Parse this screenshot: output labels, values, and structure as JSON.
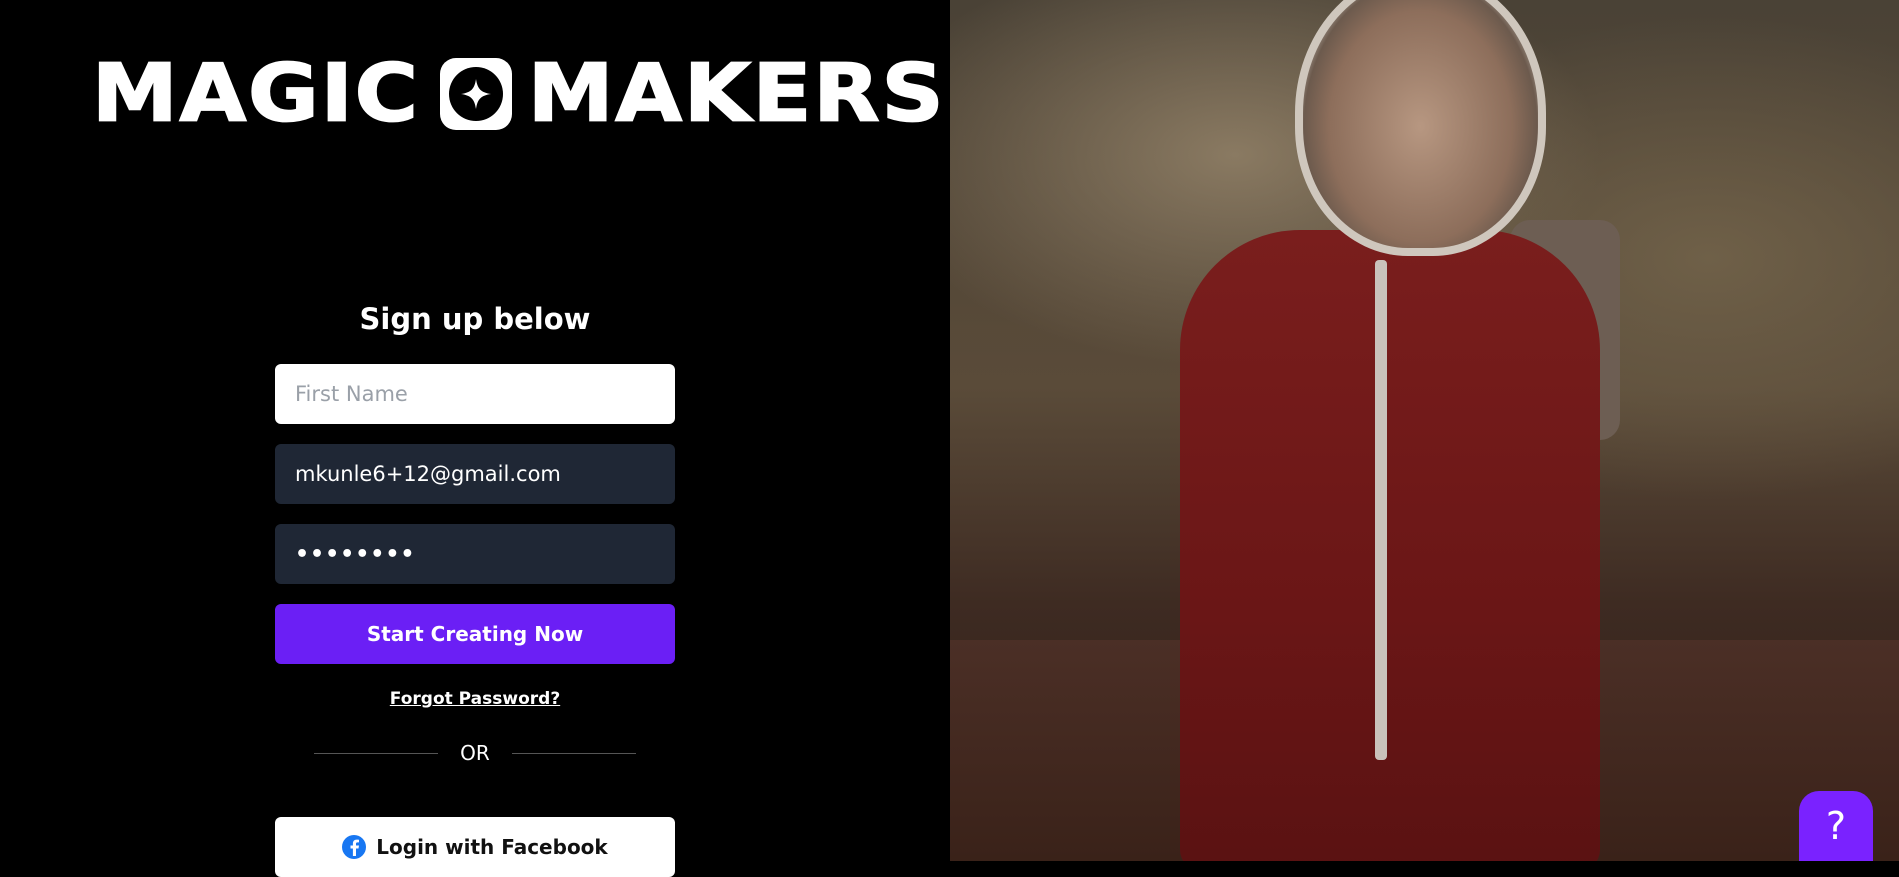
{
  "brand": {
    "word1": "MAGIC",
    "word2": "MAKERS"
  },
  "signup": {
    "title": "Sign up below",
    "first_name_placeholder": "First Name",
    "email_value": "mkunle6+12@gmail.com",
    "password_value": "••••••••",
    "submit_label": "Start Creating Now",
    "forgot_label": "Forgot Password?",
    "divider_label": "OR",
    "facebook_label": "Login with Facebook"
  },
  "help": {
    "label": "?"
  },
  "colors": {
    "primary": "#6b1ff5",
    "help": "#7a22ff",
    "input_dark": "#1f2735",
    "facebook": "#1877f2"
  },
  "icons": {
    "brand_badge": "sparkle-icon",
    "facebook": "facebook-icon",
    "help": "question-icon"
  }
}
